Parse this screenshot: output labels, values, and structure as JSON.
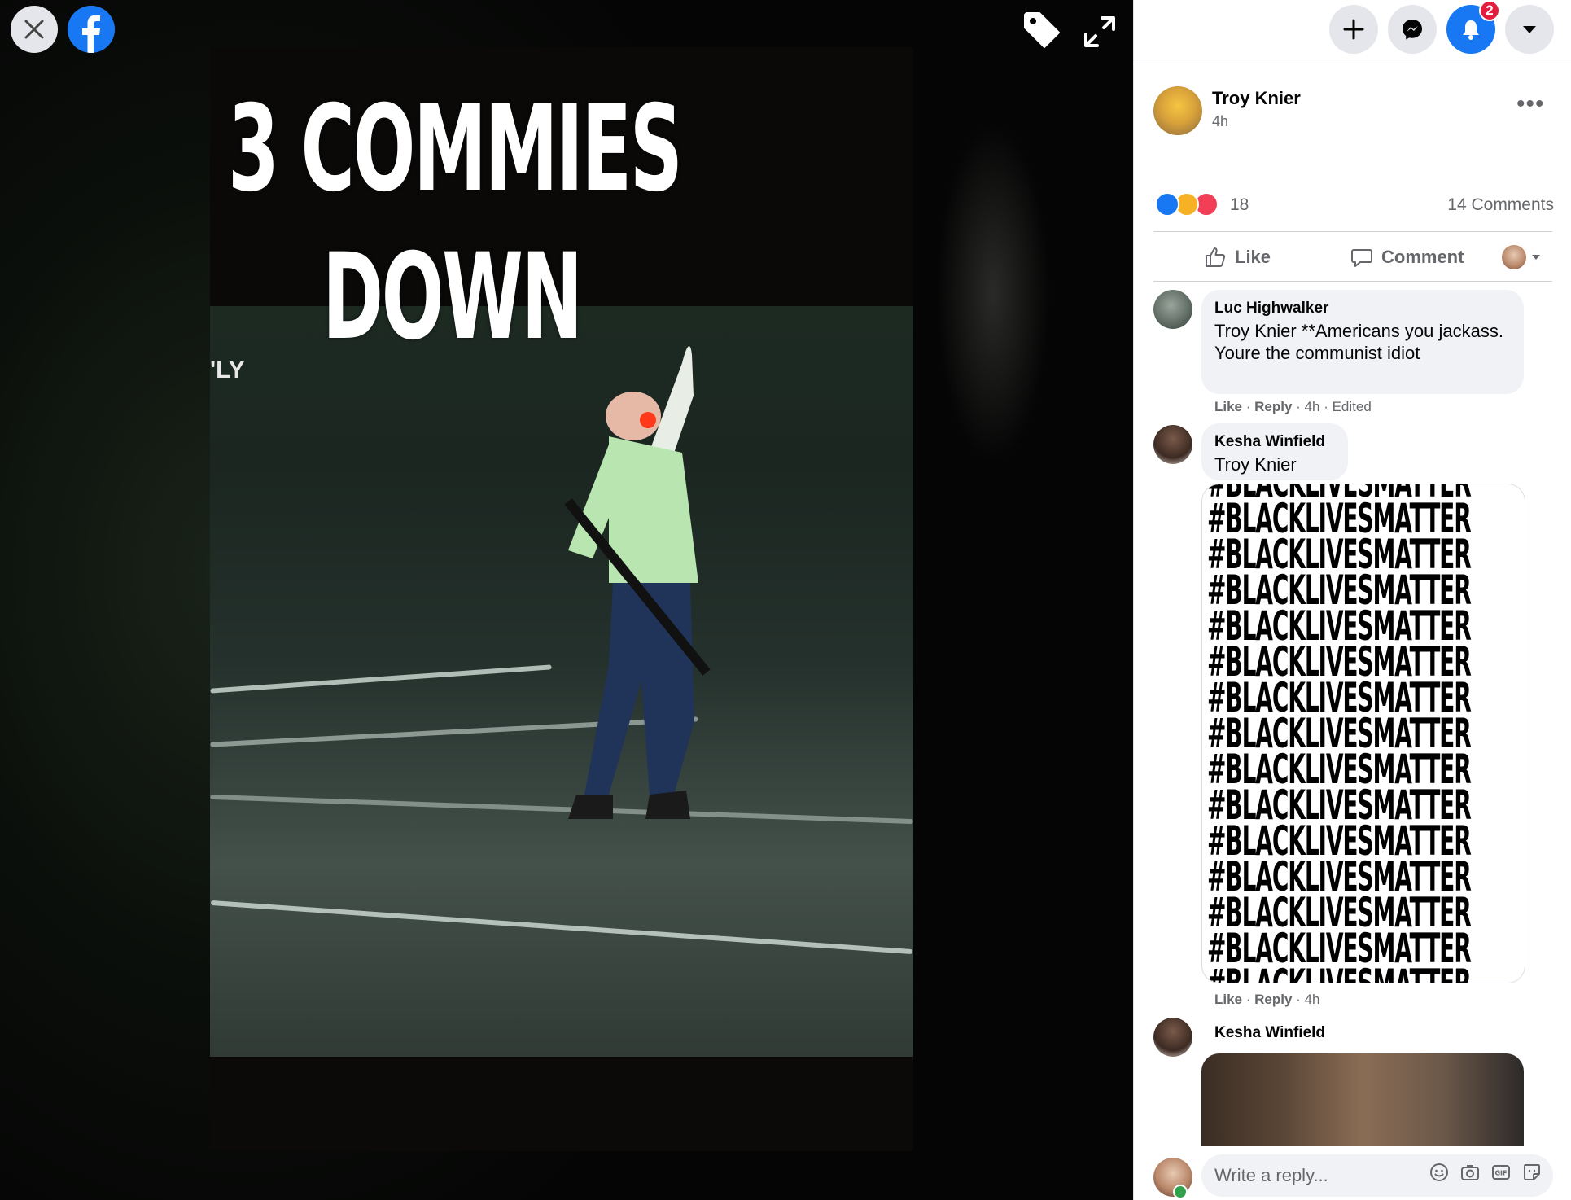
{
  "viewer": {
    "meme_line_1": "3 COMMIES",
    "meme_line_2": "DOWN",
    "watermark": "'LY",
    "icons": [
      "close-icon",
      "facebook-logo-icon",
      "tag-icon",
      "expand-icon"
    ]
  },
  "topbar": {
    "icons": [
      "plus-icon",
      "messenger-icon",
      "bell-icon",
      "caret-down-icon"
    ],
    "notification_count": "2",
    "accent_color": "#1877f2"
  },
  "post": {
    "author": "Troy Knier",
    "time": "4h",
    "more": "•••",
    "reaction_count": "18",
    "comments_count": "14 Comments",
    "like_label": "Like",
    "comment_label": "Comment"
  },
  "comments": [
    {
      "author": "Luc Highwalker",
      "text": "Troy Knier **Americans you jackass. Youre the communist idiot",
      "like": "Like",
      "reply": "Reply",
      "time": "4h",
      "edited": "Edited"
    },
    {
      "author": "Kesha Winfield",
      "text": "Troy Knier",
      "image_text": "#BLACKLIVESMATTER",
      "like": "Like",
      "reply": "Reply",
      "time": "4h"
    },
    {
      "author": "Kesha Winfield"
    }
  ],
  "reply_box": {
    "placeholder": "Write a reply...",
    "icons": [
      "emoji-icon",
      "camera-icon",
      "gif-icon",
      "sticker-icon"
    ]
  }
}
